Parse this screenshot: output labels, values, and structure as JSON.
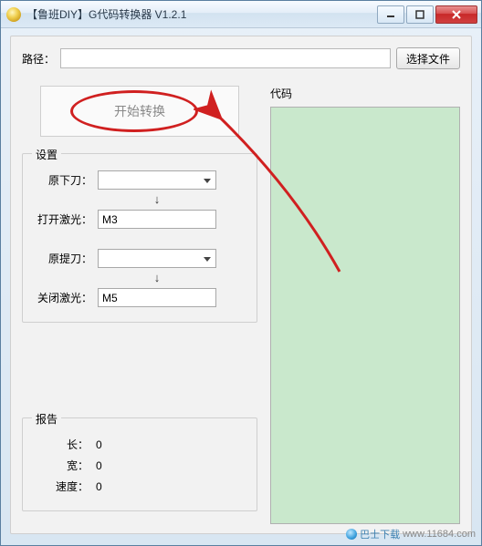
{
  "window": {
    "title": "【鲁班DIY】G代码转换器 V1.2.1"
  },
  "path": {
    "label": "路径：",
    "value": "",
    "browse_label": "选择文件"
  },
  "start": {
    "label": "开始转换"
  },
  "settings": {
    "legend": "设置",
    "orig_down_label": "原下刀：",
    "orig_down_value": "",
    "open_laser_label": "打开激光：",
    "open_laser_value": "M3",
    "orig_up_label": "原提刀：",
    "orig_up_value": "",
    "close_laser_label": "关闭激光：",
    "close_laser_value": "M5",
    "arrow_glyph": "↓"
  },
  "report": {
    "legend": "报告",
    "length_label": "长：",
    "length_value": "0",
    "width_label": "宽：",
    "width_value": "0",
    "speed_label": "速度：",
    "speed_value": "0"
  },
  "code": {
    "label": "代码"
  },
  "watermark": {
    "brand": "巴士下载",
    "url": "www.11684.com"
  }
}
